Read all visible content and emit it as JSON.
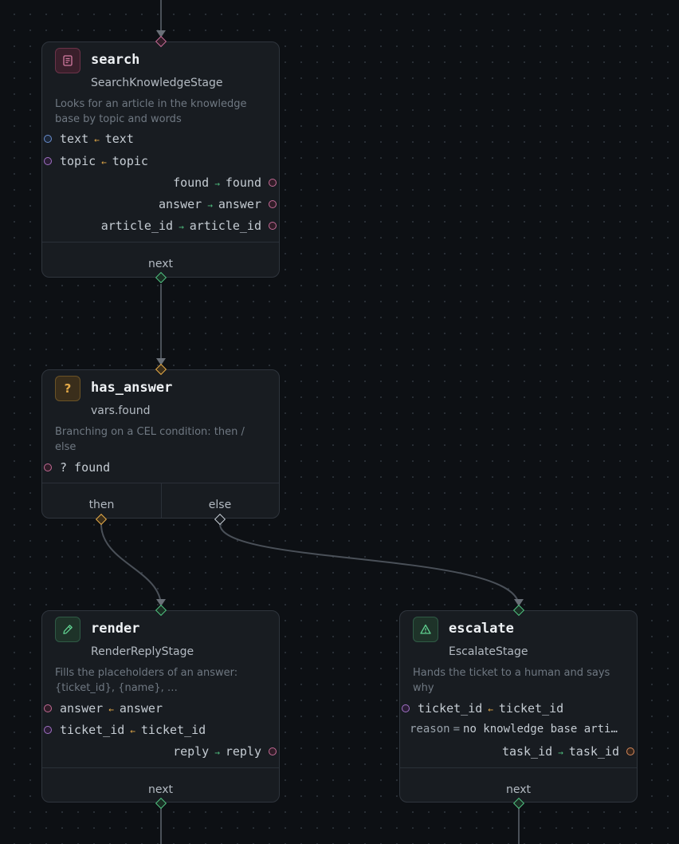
{
  "nodes": {
    "search": {
      "title": "search",
      "subtitle": "SearchKnowledgeStage",
      "description": "Looks for an article in the knowledge base by topic and words",
      "inputs": [
        {
          "from": "text",
          "to": "text"
        },
        {
          "from": "topic",
          "to": "topic"
        }
      ],
      "outputs": [
        {
          "from": "found",
          "to": "found"
        },
        {
          "from": "answer",
          "to": "answer"
        },
        {
          "from": "article_id",
          "to": "article_id"
        }
      ],
      "next_label": "next",
      "icon": "article-icon"
    },
    "has_answer": {
      "title": "has_answer",
      "icon_glyph": "?",
      "subtitle": "vars.found",
      "description": "Branching on a CEL condition: then / else",
      "condition": "? found",
      "then_label": "then",
      "else_label": "else",
      "icon": "question-icon"
    },
    "render": {
      "title": "render",
      "subtitle": "RenderReplyStage",
      "description": "Fills the placeholders of an answer: {ticket_id}, {name}, …",
      "inputs": [
        {
          "from": "answer",
          "to": "answer"
        },
        {
          "from": "ticket_id",
          "to": "ticket_id"
        }
      ],
      "outputs": [
        {
          "from": "reply",
          "to": "reply"
        }
      ],
      "next_label": "next",
      "icon": "pencil-icon"
    },
    "escalate": {
      "title": "escalate",
      "subtitle": "EscalateStage",
      "description": "Hands the ticket to a human and says why",
      "inputs": [
        {
          "from": "ticket_id",
          "to": "ticket_id"
        }
      ],
      "static_param": {
        "key": "reason",
        "eq": "=",
        "value": "no knowledge base arti…"
      },
      "outputs": [
        {
          "from": "task_id",
          "to": "task_id"
        }
      ],
      "next_label": "next",
      "icon": "warning-icon"
    }
  },
  "arrows": {
    "in": "←",
    "out": "→"
  },
  "colors": {
    "background": "#0d1014",
    "node_bg": "#181c21",
    "node_border": "#2f353d",
    "edge": "#4a5058",
    "port_pink": "#c36a95",
    "port_blue": "#6a8fd1",
    "port_purple": "#a271c7",
    "port_orange": "#d8895a",
    "handle_green": "#4fbf7f",
    "handle_amber": "#e3a948"
  }
}
